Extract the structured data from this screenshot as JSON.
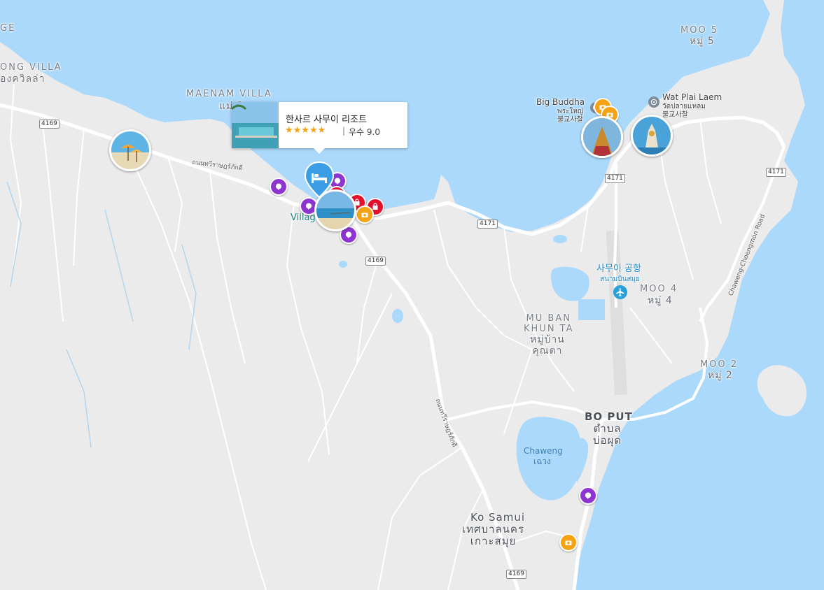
{
  "colors": {
    "water": "#aad9fb",
    "land": "#ebebeb",
    "road": "#ffffff",
    "lake": "#aad9fb",
    "accent_blue": "#3b9ee5"
  },
  "labels": {
    "ge_partial": "GE",
    "ong_villa": "ONG VILLA",
    "ong_villa_thai": "องควิลล่า",
    "maenam_villa": "MAENAM VILLA",
    "maenam_villa_thai": "แม่ วิล",
    "moo5": "MOO 5",
    "moo5_thai": "หมู่ 5",
    "moo4": "MOO 4",
    "moo4_thai": "หมู่ 4",
    "moo2": "MOO 2",
    "moo2_thai": "หมู่ 2",
    "mu_ban_khun_ta": "MU BAN\nKHUN TA",
    "mu_ban_khun_ta_thai": "หมู่บ้าน\nคุณตา",
    "bo_put": "BO PUT",
    "bo_put_thai": "ตำบล\nบ่อผุด",
    "ko_samui": "Ko Samui",
    "ko_samui_thai": "เทศบาลนคร\nเกาะสมุย",
    "chaweng": "Chaweng",
    "chaweng_thai": "เฉวง",
    "big_buddha": "Big Buddha",
    "big_buddha_thai": "พระใหญ่\n불교사찰",
    "wat_plai_laem": "Wat Plai Laem",
    "wat_plai_laem_thai": "วัดปลายแหลม\n불교사찰",
    "airport": "사무이 공항",
    "airport_thai": "สนามบินสมุย",
    "village_partial": "Villag",
    "road_thawi": "ถนนทวีราษฎร์ภักดี",
    "road_thawi_vertical": "ถนนทวีราษฎร์ภักดี",
    "road_chaweng": "Chaweng-Choengmon Road"
  },
  "shields": [
    "4169",
    "4171",
    "4169",
    "4171",
    "4171",
    "4169"
  ],
  "popup": {
    "name": "한사르 사무이 리조트",
    "stars": "★★★★★",
    "separator": "|",
    "rating": "우수 9.0"
  },
  "icons": {
    "hotel": "bed-icon",
    "purple": "chat-bubble-icon",
    "red": "shopping-bag-icon",
    "orange": "camera-icon",
    "airport": "airplane-icon",
    "temple": "dharma-wheel-icon"
  }
}
